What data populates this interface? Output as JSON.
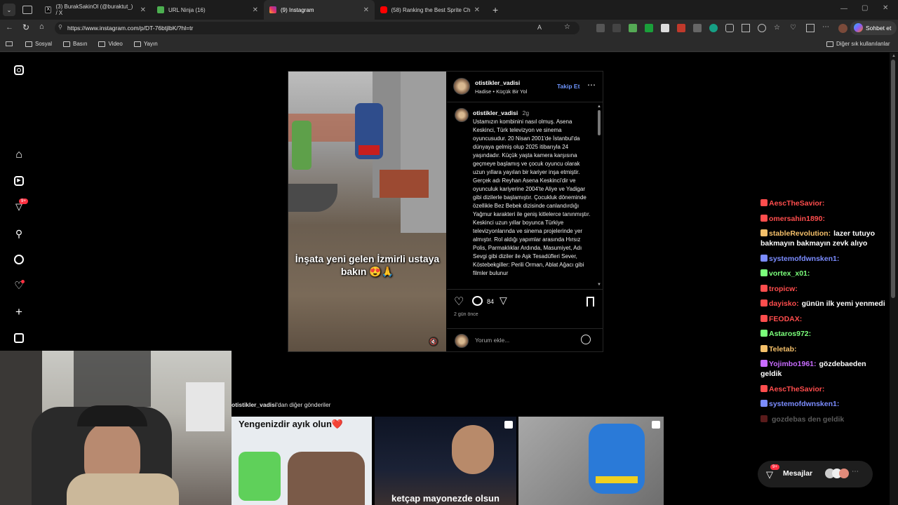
{
  "tabs": [
    {
      "label": "(3) BurakSakinOl (@buraktut_) / X",
      "color": "#ffffff"
    },
    {
      "label": "URL Ninja (16)",
      "color": "#4caf50"
    },
    {
      "label": "(9) Instagram",
      "color": "#e1306c"
    },
    {
      "label": "(58) Ranking the Best Sprite Challe",
      "color": "#ff0000"
    }
  ],
  "address": {
    "url": "https://www.instagram.com/p/DT-76btjlbK/?hl=tr",
    "chat_button": "Sohbet et"
  },
  "bookmarks": {
    "items": [
      "Sosyal",
      "Basın",
      "Video",
      "Yayın"
    ],
    "other": "Diğer sık kullanılanlar"
  },
  "sidebar": {
    "notification_badge": "9+"
  },
  "post": {
    "username": "otistikler_vadisi",
    "subtitle": "Hadise • Küçük Bir Yol",
    "follow": "Takip Et",
    "caption_overlay": "İnşata yeni gelen İzmirli ustaya bakın 😍🙏",
    "comment_author": "otistikler_vadisi",
    "comment_time": "2g",
    "comment_text": "Ustamızın kombinini nasıl olmuş.  Asena Keskinci, Türk televizyon ve sinema oyuncusudur. 20 Nisan 2001'de İstanbul'da dünyaya gelmiş olup 2025 itibarıyla 24 yaşındadır. Küçük yaşta kamera karşısına geçmeye başlamış ve çocuk oyuncu olarak uzun yıllara yayılan bir kariyer inşa etmiştir. Gerçek adı Reyhan Asena Keskinci'dir ve oyunculuk kariyerine 2004'te Aliye ve Yadigar gibi dizilerle başlamıştır. Çocukluk döneminde özellikle Bez Bebek dizisinde canlandırdığı Yağmur karakteri ile geniş kitlelerce tanınmıştır. Keskinci uzun yıllar boyunca Türkiye televizyonlarında ve sinema projelerinde yer almıştır. Rol aldığı yapımlar arasında Hırsız Polis, Parmaklıklar Ardında, Masumiyet, Adı Sevgi gibi diziler ile Aşk Tesadüfleri Sever, Köstebekgiller: Perili Orman, Ablat Ağacı gibi filmler bulunur",
    "comment_count": "84",
    "date": "2 gün önce",
    "add_comment_placeholder": "Yorum ekle..."
  },
  "more_posts": {
    "title_user": "otistikler_vadisi",
    "title_suffix": "'dan diğer gönderiler",
    "tiles": [
      {
        "text": "Yengenizdir ayık olun❤️"
      },
      {
        "text": "ketçap mayonezde olsun"
      },
      {
        "text": ""
      }
    ]
  },
  "chat": {
    "lines": [
      {
        "user": "AescTheSavior:",
        "color": "#ff4d4d",
        "msg": ""
      },
      {
        "user": "omersahin1890:",
        "color": "#ff4d4d",
        "msg": ""
      },
      {
        "user": "stableRevolution:",
        "color": "#f5c06a",
        "msg": "lazer tutuyo bakmayın bakmayın zevk alıyo"
      },
      {
        "user": "systemofdwnsken1:",
        "color": "#7b8cff",
        "msg": ""
      },
      {
        "user": "vortex_x01:",
        "color": "#7bff7b",
        "msg": ""
      },
      {
        "user": "tropicw:",
        "color": "#ff4d4d",
        "msg": ""
      },
      {
        "user": "dayisko:",
        "color": "#ff4d4d",
        "msg": "günün ilk yemi yenmedi"
      },
      {
        "user": "FEODAX:",
        "color": "#ff4d4d",
        "msg": ""
      },
      {
        "user": "Astaros972:",
        "color": "#7bff7b",
        "msg": ""
      },
      {
        "user": "Teletab:",
        "color": "#f5c06a",
        "msg": ""
      },
      {
        "user": "Yojimbo1961:",
        "color": "#c86bff",
        "msg": "gözdebaeden geldik"
      },
      {
        "user": "AescTheSavior:",
        "color": "#ff4d4d",
        "msg": ""
      },
      {
        "user": "systemofdwnsken1:",
        "color": "#7b8cff",
        "msg": ""
      },
      {
        "user": "",
        "color": "#ff4d4d",
        "msg": "gozdebas den geldik"
      }
    ],
    "messages_label": "Mesajlar",
    "messages_badge": "9+"
  }
}
